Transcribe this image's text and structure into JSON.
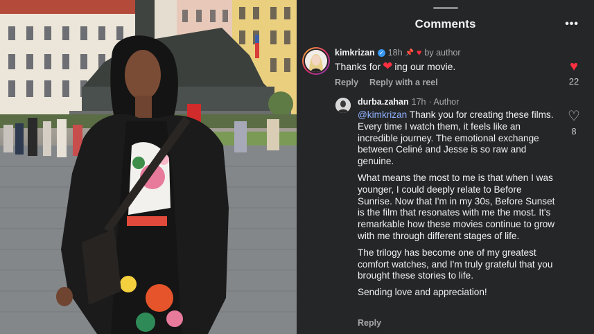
{
  "header": {
    "title": "Comments",
    "more_icon": "more-icon"
  },
  "comment": {
    "username": "kimkrizan",
    "verified": true,
    "time": "18h",
    "badge": "by author",
    "text_before": "Thanks for",
    "text_after": "ing our movie.",
    "reply_label": "Reply",
    "reply_reel_label": "Reply with a reel",
    "like_count": "22",
    "liked": true
  },
  "reply": {
    "username": "durba.zahan",
    "time": "17h",
    "author_tag": "· Author",
    "mention": "@kimkrizan",
    "paragraph_1": " Thank you for creating these films. Every time I watch them, it feels like an incredible journey. The emotional exchange between Celiné and Jesse is so raw and genuine.",
    "paragraph_2": "What means the most to me is that when I was younger, I could deeply relate to Before Sunrise. Now that I'm in my 30s, Before Sunset is the film that resonates with me the most. It's remarkable how these movies continue to grow with me through different stages of life.",
    "paragraph_3": "The trilogy has become one of my greatest comfort watches, and I'm truly grateful that you brought these stories to life.",
    "paragraph_4": "Sending love and appreciation!",
    "reply_label": "Reply",
    "like_count": "8",
    "liked": false
  },
  "colors": {
    "panel_bg": "#252628",
    "like_red": "#ff3040",
    "mention_blue": "#8fb2ff",
    "muted": "#a8a8aa"
  }
}
